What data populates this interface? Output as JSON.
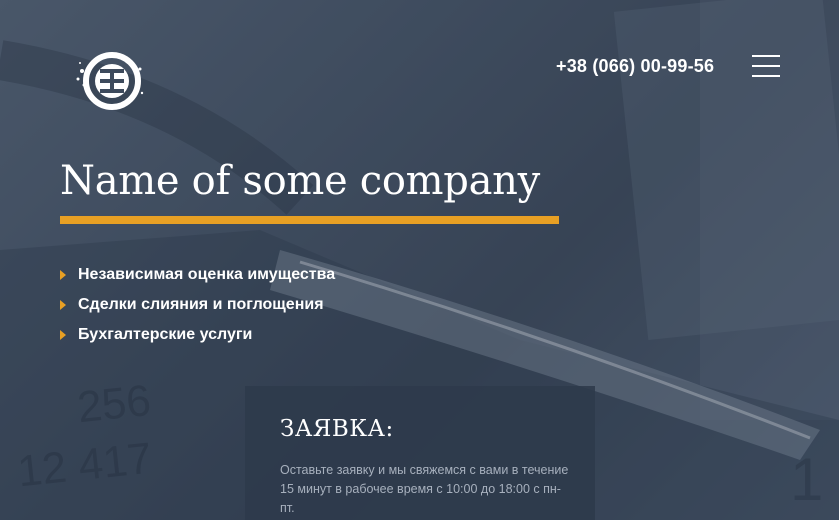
{
  "header": {
    "logo_icon": "company-logo-icon",
    "phone": "+38 (066) 00-99-56",
    "menu_icon": "hamburger-menu-icon"
  },
  "hero": {
    "title": "Name of some company",
    "accent_color": "#e8a024",
    "services": [
      "Независимая оценка имущества",
      "Сделки слияния и поглощения",
      "Бухгалтерские услуги"
    ]
  },
  "form": {
    "title": "ЗАЯВКА:",
    "description": "Оставьте заявку и мы свяжемся с вами в течение 15 минут в рабочее время с 10:00 до 18:00 с пн-пт."
  },
  "background": {
    "numbers": [
      "256",
      "12 417",
      "1"
    ]
  }
}
